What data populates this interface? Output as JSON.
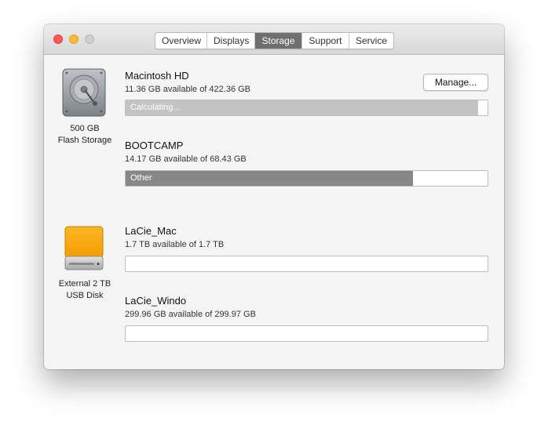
{
  "tabs": [
    {
      "label": "Overview"
    },
    {
      "label": "Displays"
    },
    {
      "label": "Storage",
      "active": true
    },
    {
      "label": "Support"
    },
    {
      "label": "Service"
    }
  ],
  "drives": [
    {
      "icon": "internal-drive-icon",
      "caption_line1": "500 GB",
      "caption_line2": "Flash Storage",
      "volumes": [
        {
          "name": "Macintosh HD",
          "available": "11.36 GB available of 422.36 GB",
          "bar_label": "Calculating...",
          "used_fraction": 0.973,
          "bar_color": "#c4c4c4"
        },
        {
          "name": "BOOTCAMP",
          "available": "14.17 GB available of 68.43 GB",
          "bar_label": "Other",
          "used_fraction": 0.793,
          "bar_color": "#878787"
        }
      ]
    },
    {
      "icon": "external-drive-icon",
      "caption_line1": "External 2 TB",
      "caption_line2": "USB Disk",
      "volumes": [
        {
          "name": "LaCie_Mac",
          "available": "1.7 TB available of 1.7 TB",
          "bar_label": "",
          "used_fraction": 0.0,
          "bar_color": "#c4c4c4"
        },
        {
          "name": "LaCie_Windo",
          "available": "299.96 GB available of 299.97 GB",
          "bar_label": "",
          "used_fraction": 0.0,
          "bar_color": "#c4c4c4"
        }
      ]
    }
  ],
  "manage_button": {
    "label": "Manage..."
  },
  "colors": {
    "accent_tab": "#6f6f6f",
    "close": "#fc5b57",
    "minimize": "#fdbc2e",
    "zoom": "#cfcfcf",
    "external_drive": "#f7a90b"
  }
}
